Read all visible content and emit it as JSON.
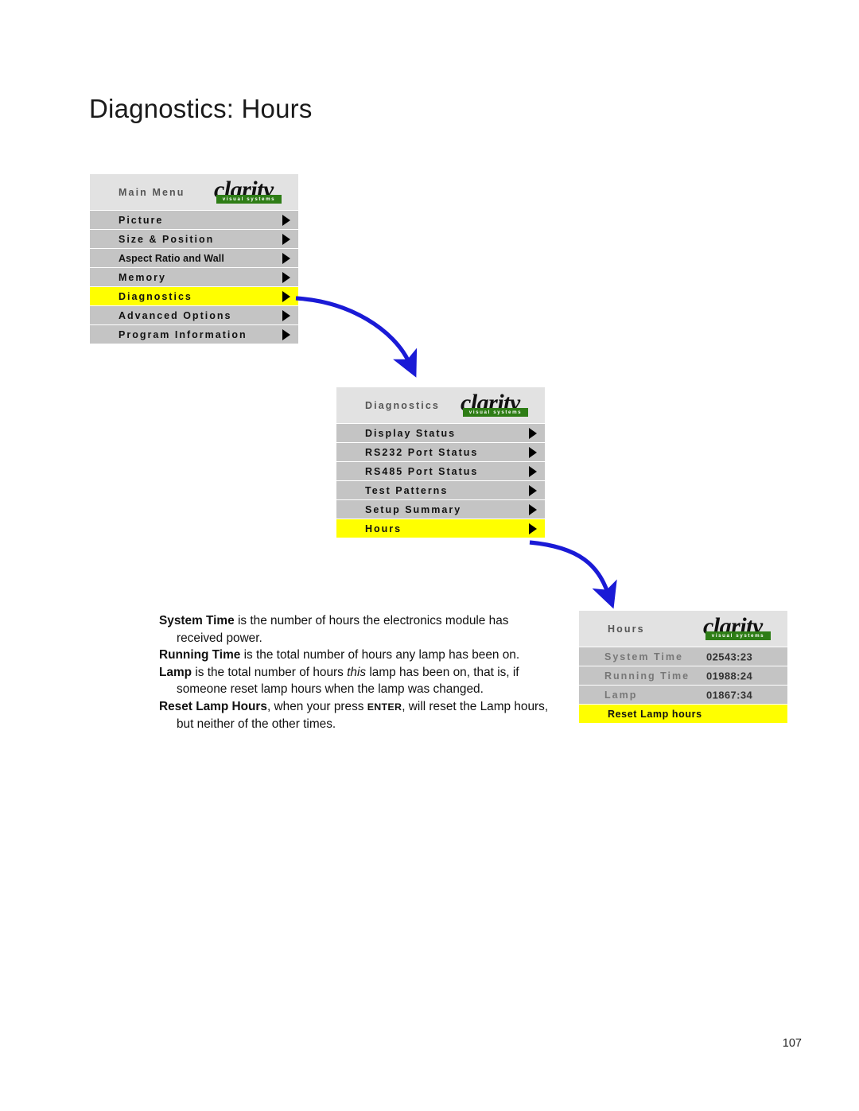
{
  "page": {
    "title": "Diagnostics: Hours",
    "number": "107",
    "accent_blue": "#1a1ad6",
    "highlight_yellow": "#ffff00",
    "row_gray": "#c4c4c4",
    "header_gray": "#e2e2e2",
    "logo_green": "#2e7d16"
  },
  "logo": {
    "word": "clarity",
    "tagline": "visual systems"
  },
  "menus": [
    {
      "name": "main-menu",
      "header_title": "Main Menu",
      "rows": [
        {
          "label": "Picture",
          "highlight": false,
          "arrow": true,
          "tight": false
        },
        {
          "label": "Size & Position",
          "highlight": false,
          "arrow": true,
          "tight": false
        },
        {
          "label": "Aspect Ratio and Wall",
          "highlight": false,
          "arrow": true,
          "tight": true
        },
        {
          "label": "Memory",
          "highlight": false,
          "arrow": true,
          "tight": false
        },
        {
          "label": "Diagnostics",
          "highlight": true,
          "arrow": true,
          "tight": false
        },
        {
          "label": "Advanced Options",
          "highlight": false,
          "arrow": true,
          "tight": false
        },
        {
          "label": "Program Information",
          "highlight": false,
          "arrow": true,
          "tight": false
        }
      ]
    },
    {
      "name": "diagnostics-menu",
      "header_title": "Diagnostics",
      "rows": [
        {
          "label": "Display Status",
          "highlight": false,
          "arrow": true,
          "tight": false
        },
        {
          "label": "RS232 Port Status",
          "highlight": false,
          "arrow": true,
          "tight": false
        },
        {
          "label": "RS485 Port Status",
          "highlight": false,
          "arrow": true,
          "tight": false
        },
        {
          "label": "Test Patterns",
          "highlight": false,
          "arrow": true,
          "tight": false
        },
        {
          "label": "Setup Summary",
          "highlight": false,
          "arrow": true,
          "tight": false
        },
        {
          "label": "Hours",
          "highlight": true,
          "arrow": true,
          "tight": false
        }
      ]
    }
  ],
  "hours_menu": {
    "name": "hours-menu",
    "header_title": "Hours",
    "value_rows": [
      {
        "label": "System Time",
        "value": "02543:23"
      },
      {
        "label": "Running Time",
        "value": "01988:24"
      },
      {
        "label": "Lamp",
        "value": "01867:34"
      }
    ],
    "action_row": {
      "label": "Reset Lamp hours",
      "highlight": true
    }
  },
  "body": {
    "paragraphs": [
      {
        "segments": [
          {
            "text": "System Time",
            "style": "bold"
          },
          {
            "text": " is the number of hours the electronics module has received power.",
            "style": "normal"
          }
        ]
      },
      {
        "segments": [
          {
            "text": "Running Time",
            "style": "bold"
          },
          {
            "text": " is the total number of hours any lamp has been on.",
            "style": "normal"
          }
        ]
      },
      {
        "segments": [
          {
            "text": "Lamp",
            "style": "bold"
          },
          {
            "text": " is the total number of hours ",
            "style": "normal"
          },
          {
            "text": "this",
            "style": "italic"
          },
          {
            "text": " lamp has been on, that is, if someone reset lamp hours when the lamp was changed.",
            "style": "normal"
          }
        ]
      },
      {
        "segments": [
          {
            "text": "Reset Lamp Hours",
            "style": "bold"
          },
          {
            "text": ", when your press ",
            "style": "normal"
          },
          {
            "text": "ENTER",
            "style": "smallcaps"
          },
          {
            "text": ", will reset the Lamp hours, but neither of the other times.",
            "style": "normal"
          }
        ]
      }
    ]
  }
}
